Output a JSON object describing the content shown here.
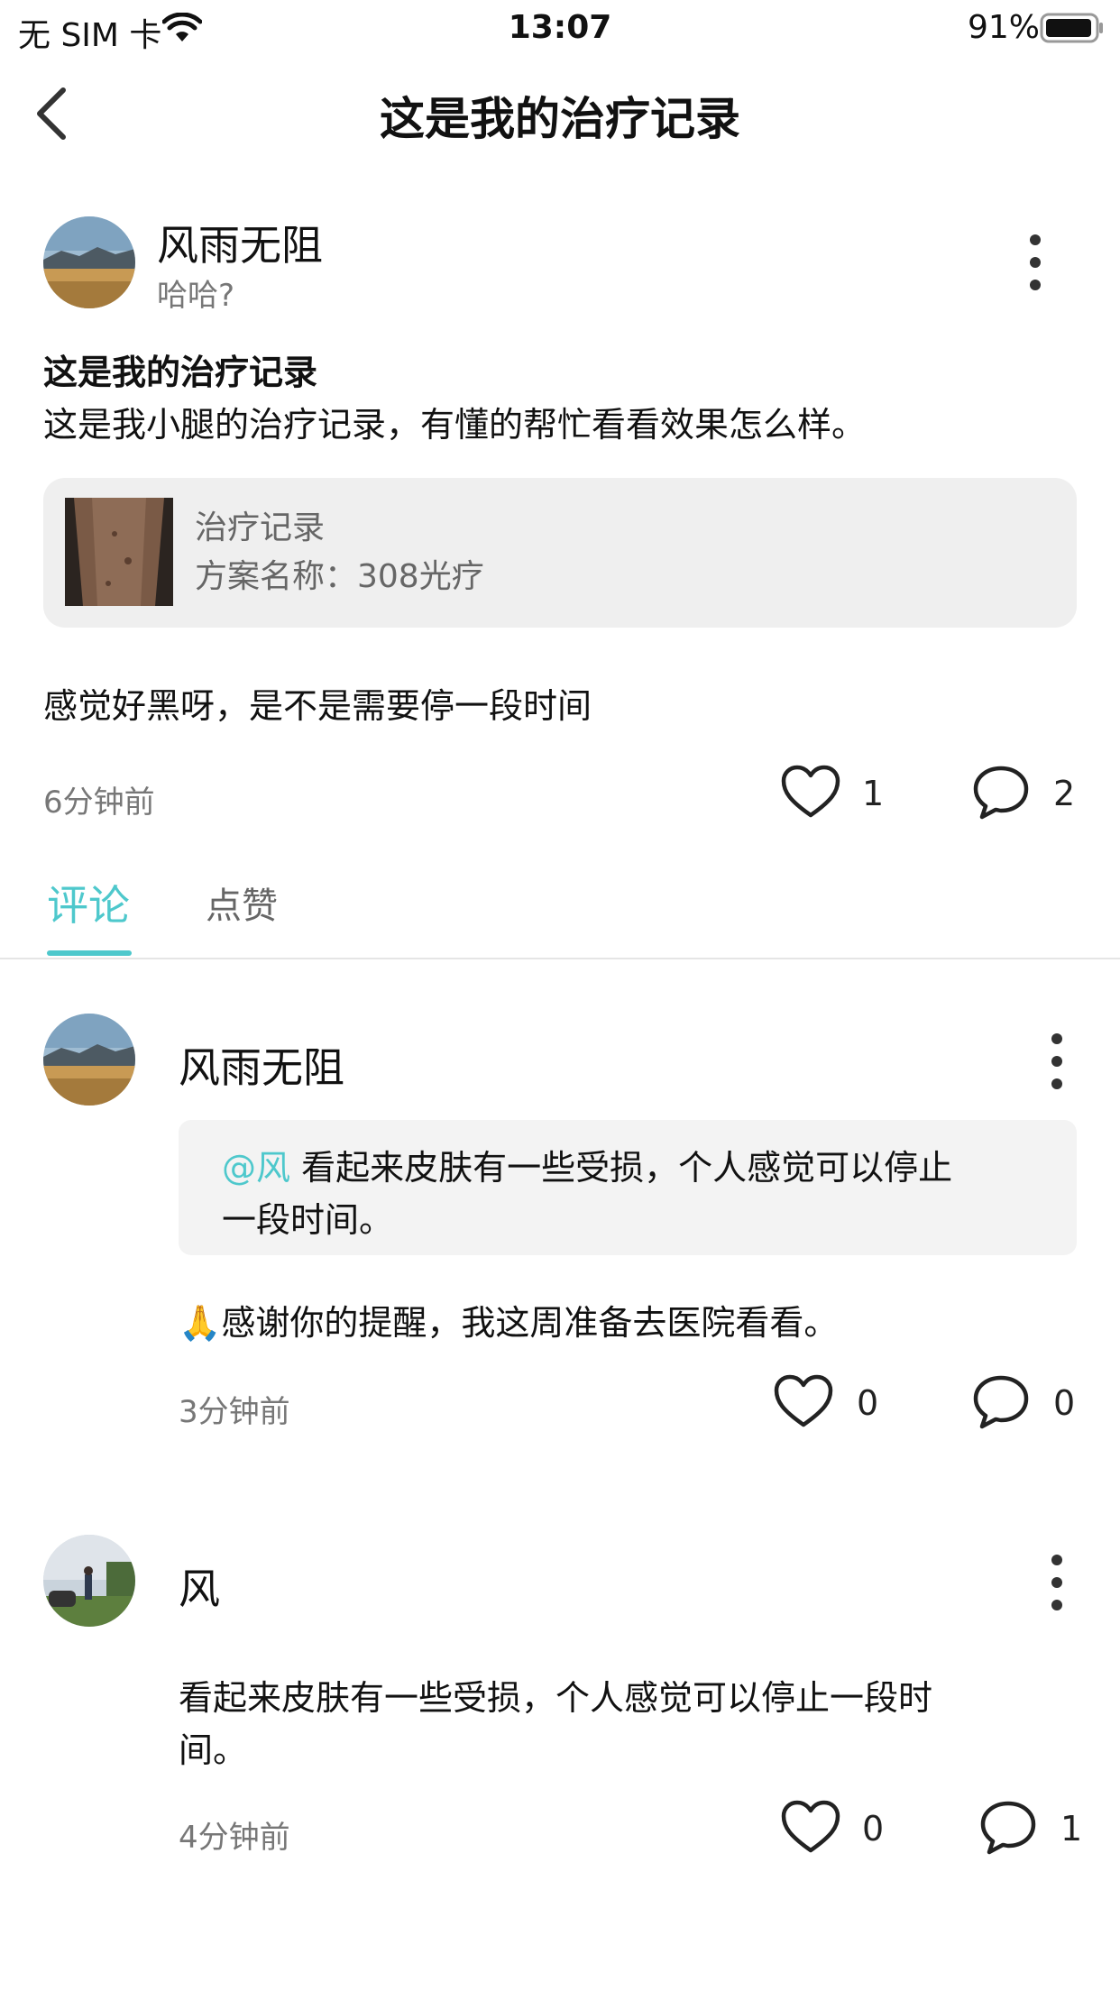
{
  "status_bar": {
    "carrier": "无 SIM 卡",
    "time": "13:07",
    "battery": "91%"
  },
  "nav": {
    "title": "这是我的治疗记录"
  },
  "post": {
    "author": "风雨无阻",
    "subtitle": "哈哈?",
    "title": "这是我的治疗记录",
    "content": "这是我小腿的治疗记录，有懂的帮忙看看效果怎么样。",
    "record": {
      "label": "治疗记录",
      "plan": "方案名称：308光疗"
    },
    "comment_text": "感觉好黑呀，是不是需要停一段时间",
    "time": "6分钟前",
    "likes": "1",
    "comments": "2"
  },
  "tabs": {
    "comments": "评论",
    "likes": "点赞"
  },
  "replies": [
    {
      "author": "风雨无阻",
      "quote_mention": "@风",
      "quote_text_line1": " 看起来皮肤有一些受损，个人感觉可以停止",
      "quote_text_line2": "一段时间。",
      "emoji": "🙏",
      "text": "感谢你的提醒，我这周准备去医院看看。",
      "time": "3分钟前",
      "likes": "0",
      "comments": "0"
    },
    {
      "author": "风",
      "text_line1": "看起来皮肤有一些受损，个人感觉可以停止一段时",
      "text_line2": "间。",
      "time": "4分钟前",
      "likes": "0",
      "comments": "1"
    }
  ],
  "colors": {
    "accent": "#4ec8cc",
    "card_bg": "#efefef",
    "divider": "#e5e5e5"
  },
  "icons": [
    "wifi-icon",
    "battery-icon",
    "back-chevron-icon",
    "more-vertical-icon",
    "heart-icon",
    "comment-bubble-icon"
  ]
}
